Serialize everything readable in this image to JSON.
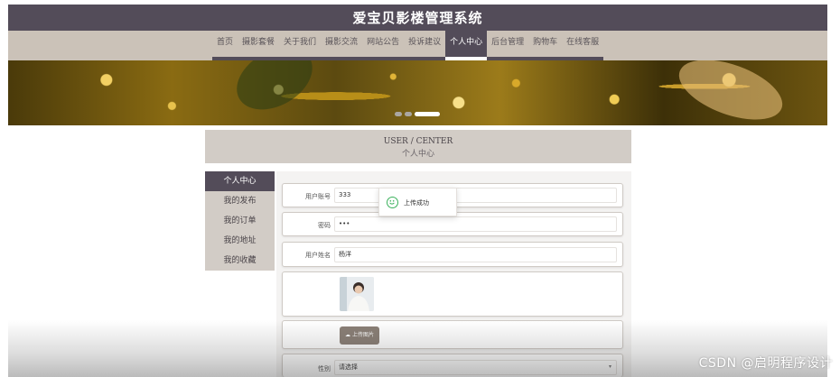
{
  "site": {
    "title": "爱宝贝影楼管理系统"
  },
  "nav": {
    "items": [
      {
        "label": "首页"
      },
      {
        "label": "摄影套餐"
      },
      {
        "label": "关于我们"
      },
      {
        "label": "摄影交流"
      },
      {
        "label": "网站公告"
      },
      {
        "label": "投诉建议"
      },
      {
        "label": "个人中心",
        "active": true
      },
      {
        "label": "后台管理"
      },
      {
        "label": "购物车"
      },
      {
        "label": "在线客服"
      }
    ]
  },
  "banner": {
    "slides": 3,
    "active_slide": 3
  },
  "user_center": {
    "title_en": "USER / CENTER",
    "title_cn": "个人中心"
  },
  "sidebar": {
    "items": [
      {
        "label": "个人中心",
        "active": true
      },
      {
        "label": "我的发布"
      },
      {
        "label": "我的订单"
      },
      {
        "label": "我的地址"
      },
      {
        "label": "我的收藏"
      }
    ]
  },
  "form": {
    "username": {
      "label": "用户账号",
      "value": "333"
    },
    "password": {
      "label": "密码",
      "value": "•••"
    },
    "realname": {
      "label": "用户姓名",
      "value": "杨洋"
    },
    "upload": {
      "label": "上传图片"
    },
    "gender": {
      "label": "性别",
      "value": "请选择"
    }
  },
  "toast": {
    "message": "上传成功"
  },
  "watermark": "CSDN @启明程序设计",
  "colors": {
    "header": "#534c59",
    "nav_bg": "#cbc2b8",
    "panel": "#d2ccc6",
    "success": "#3ab15b"
  }
}
